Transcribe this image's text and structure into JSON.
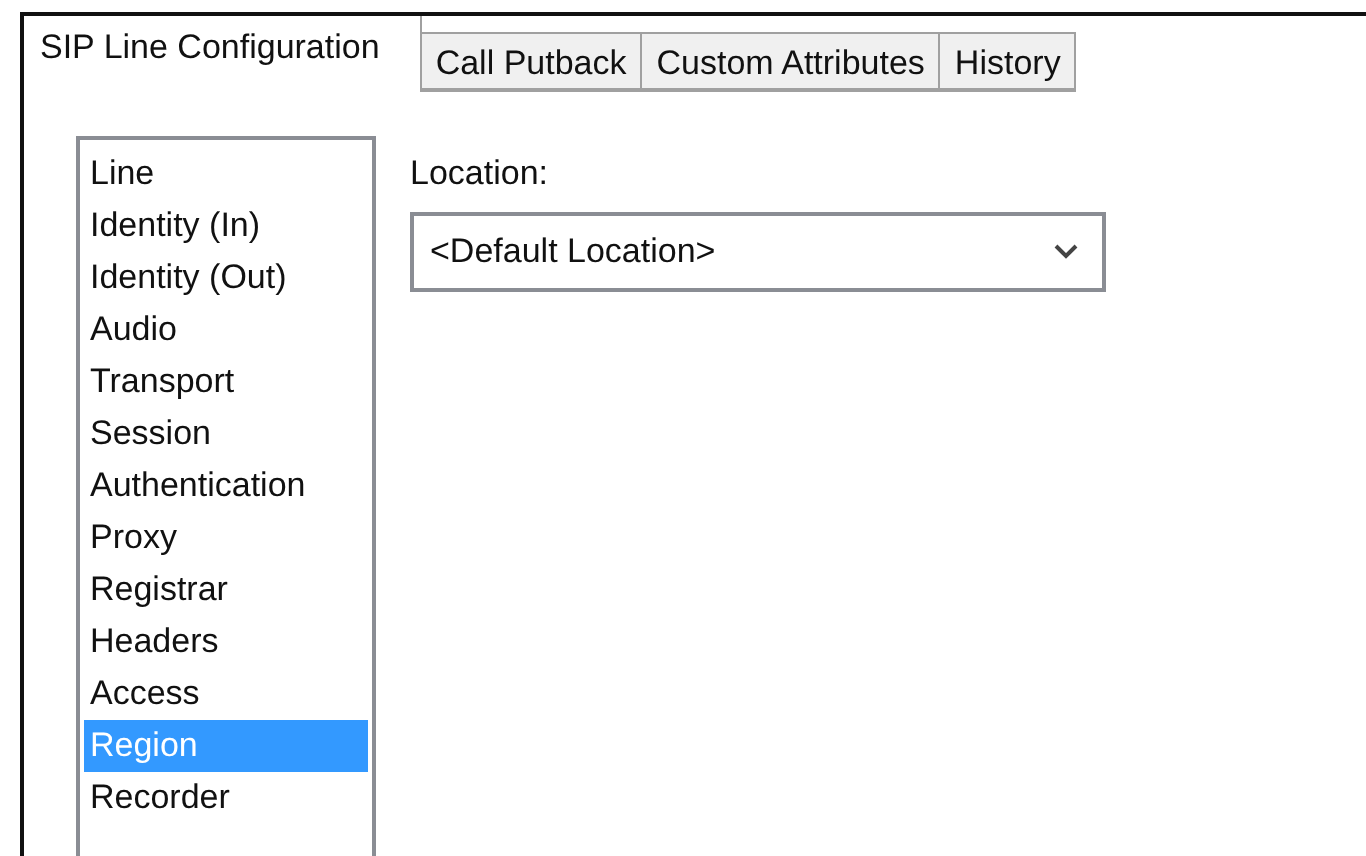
{
  "tabs": [
    {
      "label": "SIP Line Configuration",
      "selected": true
    },
    {
      "label": "Call Putback",
      "selected": false
    },
    {
      "label": "Custom Attributes",
      "selected": false
    },
    {
      "label": "History",
      "selected": false
    }
  ],
  "sections": [
    {
      "label": "Line",
      "selected": false
    },
    {
      "label": "Identity (In)",
      "selected": false
    },
    {
      "label": "Identity (Out)",
      "selected": false
    },
    {
      "label": "Audio",
      "selected": false
    },
    {
      "label": "Transport",
      "selected": false
    },
    {
      "label": "Session",
      "selected": false
    },
    {
      "label": "Authentication",
      "selected": false
    },
    {
      "label": "Proxy",
      "selected": false
    },
    {
      "label": "Registrar",
      "selected": false
    },
    {
      "label": "Headers",
      "selected": false
    },
    {
      "label": "Access",
      "selected": false
    },
    {
      "label": "Region",
      "selected": true
    },
    {
      "label": "Recorder",
      "selected": false
    }
  ],
  "location": {
    "label": "Location:",
    "value": "<Default Location>"
  }
}
